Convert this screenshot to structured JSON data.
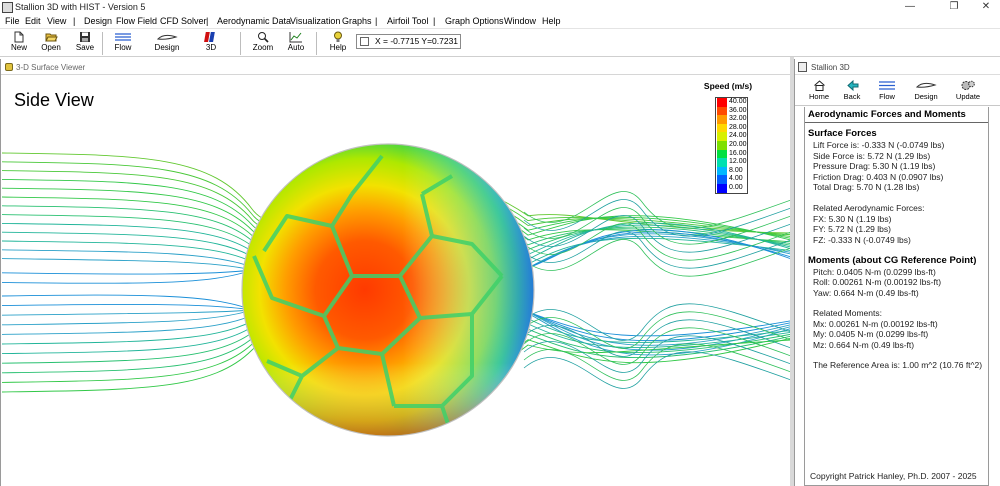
{
  "window": {
    "title": "Stallion 3D with HIST - Version 5",
    "controls": {
      "minimize": "—",
      "maximize": "❐",
      "close": "✕"
    }
  },
  "menu": {
    "items": [
      "File",
      "Edit",
      "View",
      "|",
      "Design",
      "Flow Field",
      "CFD Solver",
      "|",
      "Aerodynamic Data",
      "Visualization",
      "Graphs",
      "|",
      "Airfoil Tool",
      "|",
      "Graph Options",
      "Window",
      "Help"
    ]
  },
  "toolbar": {
    "buttons": [
      {
        "label": "New",
        "icon": "new-document-icon"
      },
      {
        "label": "Open",
        "icon": "open-folder-icon"
      },
      {
        "label": "Save",
        "icon": "save-disk-icon"
      },
      {
        "label": "Flow",
        "icon": "flow-lines-icon"
      },
      {
        "label": "Design",
        "icon": "design-airfoil-icon"
      },
      {
        "label": "3D",
        "icon": "3d-view-icon"
      },
      {
        "label": "Zoom",
        "icon": "zoom-magnifier-icon"
      },
      {
        "label": "Auto",
        "icon": "auto-chart-icon"
      },
      {
        "label": "Help",
        "icon": "help-bulb-icon"
      }
    ],
    "coordinates": "X = -0.7715  Y=0.7231"
  },
  "viewer": {
    "window_title": "3-D Surface Viewer",
    "view_label": "Side View",
    "legend": {
      "title": "Speed (m/s)",
      "entries": [
        {
          "value": "40.00",
          "color": "#ff0000"
        },
        {
          "value": "36.00",
          "color": "#ff4a00"
        },
        {
          "value": "32.00",
          "color": "#ff9a00"
        },
        {
          "value": "28.00",
          "color": "#ffd800"
        },
        {
          "value": "24.00",
          "color": "#d8f000"
        },
        {
          "value": "20.00",
          "color": "#7ee000"
        },
        {
          "value": "16.00",
          "color": "#00e040"
        },
        {
          "value": "12.00",
          "color": "#00e0b0"
        },
        {
          "value": "8.00",
          "color": "#00b8ff"
        },
        {
          "value": "4.00",
          "color": "#0060ff"
        },
        {
          "value": "0.00",
          "color": "#0000ff"
        }
      ]
    }
  },
  "panel": {
    "window_title": "Stallion 3D",
    "buttons": [
      {
        "label": "Home",
        "icon": "home-icon"
      },
      {
        "label": "Back",
        "icon": "back-arrow-icon"
      },
      {
        "label": "Flow",
        "icon": "flow-lines-icon"
      },
      {
        "label": "Design",
        "icon": "design-airfoil-icon"
      },
      {
        "label": "Update",
        "icon": "update-gears-icon"
      }
    ],
    "heading": "Aerodynamic Forces and Moments",
    "surface_forces": {
      "title": "Surface Forces",
      "lines": [
        "Lift Force is: -0.333 N (-0.0749 lbs)",
        "Side Force is: 5.72 N (1.29 lbs)",
        "Pressure Drag: 5.30 N (1.19 lbs)",
        "Friction Drag: 0.403 N (0.0907 lbs)",
        "Total Drag: 5.70 N (1.28 lbs)"
      ]
    },
    "related_forces": {
      "title": "Related Aerodynamic Forces:",
      "lines": [
        "FX: 5.30 N (1.19 lbs)",
        "FY: 5.72 N (1.29 lbs)",
        "FZ: -0.333 N (-0.0749 lbs)"
      ]
    },
    "moments": {
      "title": "Moments (about CG Reference Point)",
      "lines": [
        "Pitch: 0.0405 N-m (0.0299 lbs-ft)",
        "Roll: 0.00261 N-m (0.00192 lbs-ft)",
        "Yaw: 0.664 N-m (0.49 lbs-ft)"
      ]
    },
    "related_moments": {
      "title": "Related Moments:",
      "lines": [
        "Mx: 0.00261 N-m (0.00192 lbs-ft)",
        "My: 0.0405 N-m (0.0299 lbs-ft)",
        "Mz: 0.664 N-m (0.49 lbs-ft)"
      ]
    },
    "reference_area": "The Reference Area is: 1.00 m^2 (10.76 ft^2)",
    "copyright": "Copyright Patrick Hanley, Ph.D. 2007 - 2025"
  }
}
